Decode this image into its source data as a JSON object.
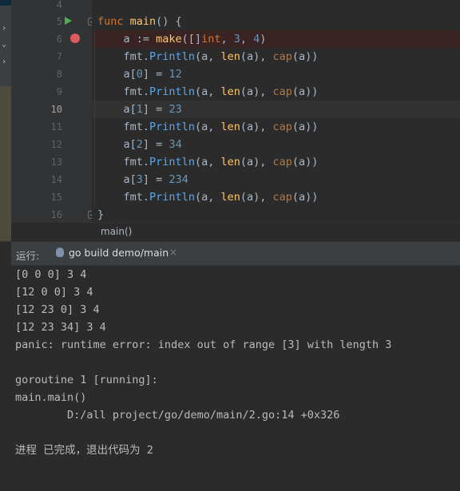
{
  "editor": {
    "line_numbers": [
      "4",
      "5",
      "6",
      "7",
      "8",
      "9",
      "10",
      "11",
      "12",
      "13",
      "14",
      "15",
      "16"
    ],
    "lines": [
      {
        "n": "5",
        "text": "func main() {"
      },
      {
        "n": "6",
        "text": "a := make([]int, 3, 4)"
      },
      {
        "n": "7",
        "text": "fmt.Println(a, len(a), cap(a))"
      },
      {
        "n": "8",
        "text": "a[0] = 12"
      },
      {
        "n": "9",
        "text": "fmt.Println(a, len(a), cap(a))"
      },
      {
        "n": "10",
        "text": "a[1] = 23"
      },
      {
        "n": "11",
        "text": "fmt.Println(a, len(a), cap(a))"
      },
      {
        "n": "12",
        "text": "a[2] = 34"
      },
      {
        "n": "13",
        "text": "fmt.Println(a, len(a), cap(a))"
      },
      {
        "n": "14",
        "text": "a[3] = 234"
      },
      {
        "n": "15",
        "text": "fmt.Println(a, len(a), cap(a))"
      },
      {
        "n": "16",
        "text": "}"
      }
    ],
    "breadcrumb": "main()"
  },
  "run_panel": {
    "label": "运行:",
    "tab_label": "go build demo/main",
    "close_glyph": "×",
    "output": [
      "[0 0 0] 3 4",
      "[12 0 0] 3 4",
      "[12 23 0] 3 4",
      "[12 23 34] 3 4",
      "panic: runtime error: index out of range [3] with length 3",
      "",
      "goroutine 1 [running]:",
      "main.main()",
      "        D:/all project/go/demo/main/2.go:14 +0x326",
      "",
      "进程 已完成，退出代码为 2"
    ]
  },
  "colors": {
    "keyword": "#cc7832",
    "function": "#ffc66d",
    "number": "#6897bb",
    "breakpoint": "#db5c5c",
    "run_gutter": "#4eae4b",
    "tab_underline": "#4a88c7"
  },
  "icons": {
    "run_gutter": "run-triangle-icon",
    "breakpoint": "breakpoint-icon",
    "tab": "gopher-icon"
  }
}
